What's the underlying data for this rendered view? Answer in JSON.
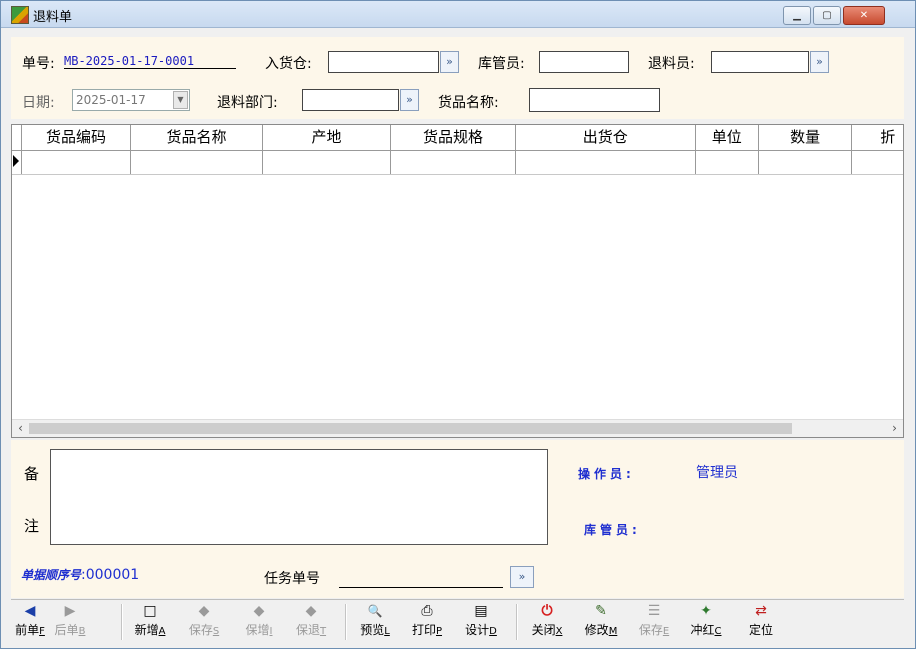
{
  "window": {
    "title": "退料单"
  },
  "header": {
    "doc_no_label": "单号:",
    "doc_no": "MB-2025-01-17-0001",
    "warehouse_in_label": "入货仓:",
    "warehouse_in_value": "",
    "keeper_label": "库管员:",
    "keeper_value": "",
    "returner_label": "退料员:",
    "returner_value": "",
    "date_label": "日期:",
    "date_value": "2025-01-17",
    "dept_label": "退料部门:",
    "dept_value": "",
    "goods_name_label": "货品名称:",
    "goods_name_value": "",
    "browse_glyph": "»"
  },
  "grid": {
    "columns": [
      "货品编码",
      "货品名称",
      "产地",
      "货品规格",
      "出货仓",
      "单位",
      "数量",
      "折"
    ],
    "rows": [
      [
        "",
        "",
        "",
        "",
        "",
        "",
        "",
        ""
      ]
    ]
  },
  "bottom": {
    "memo_label_1": "备",
    "memo_label_2": "注",
    "memo_value": "",
    "operator_label": "操作员:",
    "operator_value": "管理员",
    "keeper_label": "库管员:",
    "keeper_value": "",
    "seq_label": "单据顺序号",
    "seq_value": ":000001",
    "task_label": "任务单号",
    "task_value": ""
  },
  "toolbar": [
    {
      "name": "prev",
      "icon": "arrow-left-icon",
      "text": "前单",
      "key": "F",
      "enabled": true,
      "glyph": "◀"
    },
    {
      "name": "next",
      "icon": "arrow-right-icon",
      "text": "后单",
      "key": "B",
      "enabled": false,
      "glyph": "▶"
    },
    {
      "name": "new",
      "icon": "new-doc-icon",
      "text": "新增",
      "key": "A",
      "enabled": true,
      "glyph": "□"
    },
    {
      "name": "save",
      "icon": "save-icon",
      "text": "保存",
      "key": "S",
      "enabled": false,
      "glyph": "◆"
    },
    {
      "name": "save-add",
      "icon": "save-add-icon",
      "text": "保增",
      "key": "I",
      "enabled": false,
      "glyph": "◆"
    },
    {
      "name": "save-exit",
      "icon": "save-exit-icon",
      "text": "保退",
      "key": "T",
      "enabled": false,
      "glyph": "◆"
    },
    {
      "name": "preview",
      "icon": "preview-icon",
      "text": "预览",
      "key": "L",
      "enabled": true,
      "glyph": "🔍"
    },
    {
      "name": "print",
      "icon": "print-icon",
      "text": "打印",
      "key": "P",
      "enabled": true,
      "glyph": "⎙"
    },
    {
      "name": "design",
      "icon": "design-icon",
      "text": "设计",
      "key": "D",
      "enabled": true,
      "glyph": "▤"
    },
    {
      "name": "close",
      "icon": "close-power-icon",
      "text": "关闭",
      "key": "X",
      "enabled": true,
      "glyph": "⏻"
    },
    {
      "name": "modify",
      "icon": "modify-icon",
      "text": "修改",
      "key": "M",
      "enabled": true,
      "glyph": "✎"
    },
    {
      "name": "save2",
      "icon": "save-list-icon",
      "text": "保存",
      "key": "E",
      "enabled": false,
      "glyph": "☰"
    },
    {
      "name": "reverse",
      "icon": "reverse-icon",
      "text": "冲红",
      "key": "C",
      "enabled": true,
      "glyph": "✦"
    },
    {
      "name": "locate",
      "icon": "locate-icon",
      "text": "定位",
      "key": "",
      "enabled": true,
      "glyph": "⇄"
    }
  ],
  "colors": {
    "accent_blue": "#1f2fd0",
    "header_bg": "#fdf7ea",
    "close_red": "#c74a30"
  }
}
